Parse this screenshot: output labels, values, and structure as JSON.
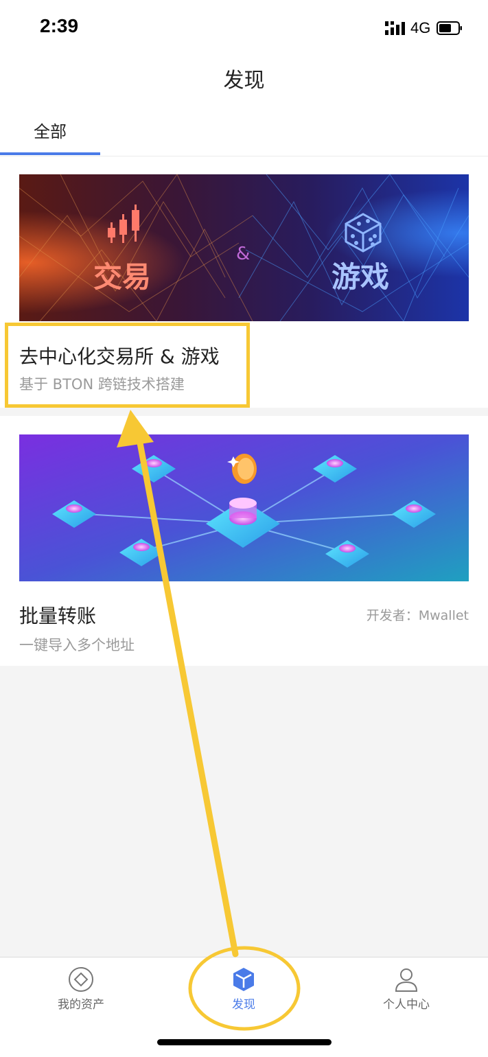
{
  "status": {
    "time": "2:39",
    "network": "4G"
  },
  "nav": {
    "title": "发现"
  },
  "tabs": [
    {
      "label": "全部"
    }
  ],
  "cards": [
    {
      "banner_left": "交易",
      "banner_amp": "&",
      "banner_right": "游戏",
      "title": "去中心化交易所 & 游戏",
      "subtitle": "基于 BTON 跨链技术搭建",
      "developer": ""
    },
    {
      "title": "批量转账",
      "subtitle": "一键导入多个地址",
      "developer": "开发者：Mwallet"
    }
  ],
  "tabbar": [
    {
      "label": "我的资产",
      "icon": "diamond-icon"
    },
    {
      "label": "发现",
      "icon": "cube-icon"
    },
    {
      "label": "个人中心",
      "icon": "person-icon"
    }
  ],
  "colors": {
    "accent": "#4a7be8",
    "highlight": "#f7c834"
  }
}
